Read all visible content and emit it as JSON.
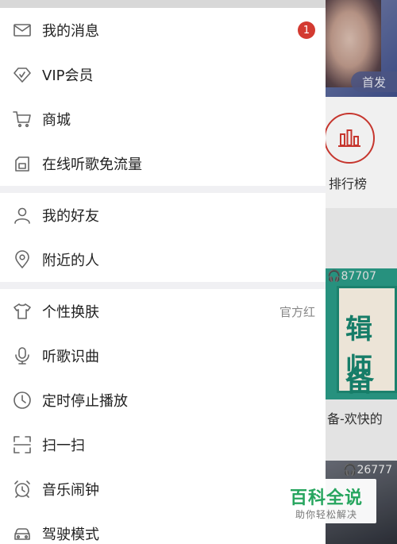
{
  "background": {
    "banner_button": "首发",
    "rank_label": "排行榜",
    "card1_play_count": "87707",
    "card1_text_line1": "辑师",
    "card1_text_line2": "备",
    "card1_caption": "备-欢快的",
    "card2_play_count": "26777",
    "accent_color": "#d33a31",
    "card_color": "#2a9b86"
  },
  "drawer": {
    "group1": [
      {
        "label": "我的消息",
        "icon": "mail-icon",
        "badge": "1"
      },
      {
        "label": "VIP会员",
        "icon": "vip-diamond-icon"
      },
      {
        "label": "商城",
        "icon": "cart-icon"
      },
      {
        "label": "在线听歌免流量",
        "icon": "sim-card-icon"
      }
    ],
    "group2": [
      {
        "label": "我的好友",
        "icon": "person-icon"
      },
      {
        "label": "附近的人",
        "icon": "location-pin-icon"
      }
    ],
    "group3": [
      {
        "label": "个性换肤",
        "icon": "tshirt-icon",
        "value": "官方红"
      },
      {
        "label": "听歌识曲",
        "icon": "microphone-icon"
      },
      {
        "label": "定时停止播放",
        "icon": "clock-icon"
      },
      {
        "label": "扫一扫",
        "icon": "scan-icon"
      },
      {
        "label": "音乐闹钟",
        "icon": "alarm-clock-icon"
      },
      {
        "label": "驾驶模式",
        "icon": "car-icon"
      }
    ]
  },
  "watermark": {
    "title": "百科全说",
    "subtitle": "助你轻松解决"
  }
}
